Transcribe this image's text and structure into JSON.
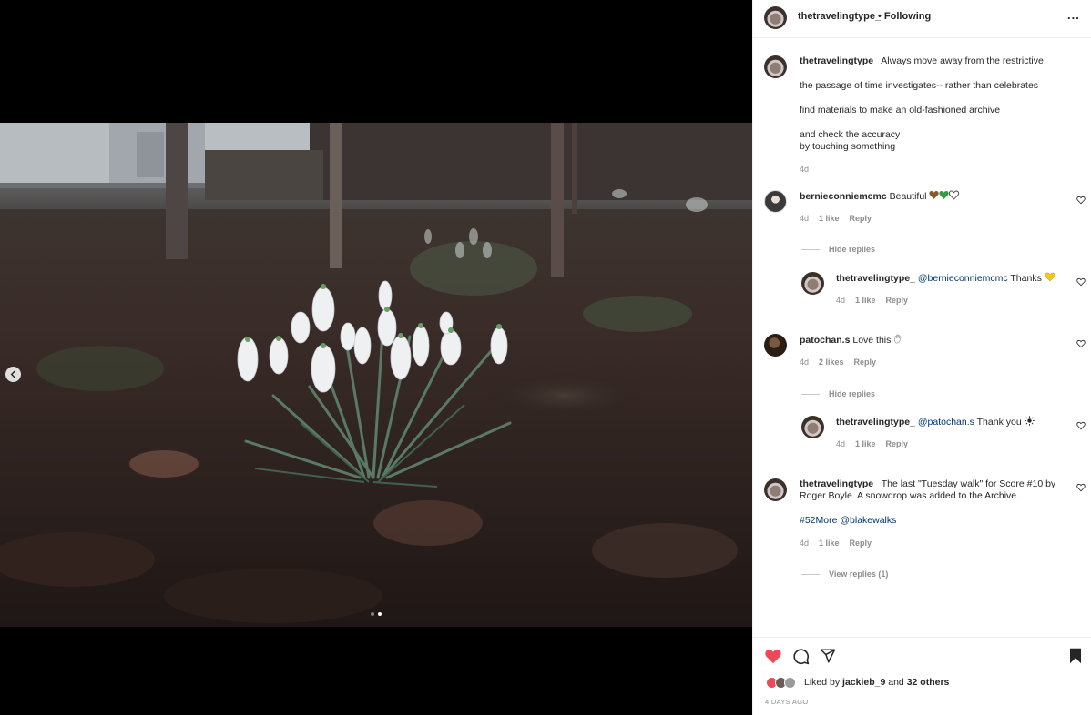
{
  "post": {
    "author": "thetravelingtype_",
    "separator": "•",
    "follow_status": "Following",
    "more_label": "...",
    "carousel": {
      "slide_count": 2,
      "active_slide": 2
    }
  },
  "caption": {
    "username": "thetravelingtype_",
    "line1": "Always move away from the restrictive",
    "line2": "the passage of time investigates-- rather than celebrates",
    "line3": "find materials to make an old-fashioned archive",
    "line4": "and check the accuracy",
    "line5": "by touching something",
    "time": "4d"
  },
  "comments": [
    {
      "username": "bernieconniemcmc",
      "text": "Beautiful",
      "emoji": [
        "brown-heart",
        "green-heart",
        "white-heart"
      ],
      "time": "4d",
      "likes": "1 like",
      "reply_label": "Reply",
      "toggle_label": "Hide replies",
      "reply": {
        "username": "thetravelingtype_",
        "mention": "@bernieconniemcmc",
        "text": "Thanks",
        "emoji": "yellow-heart",
        "time": "4d",
        "likes": "1 like",
        "reply_label": "Reply"
      }
    },
    {
      "username": "patochan.s",
      "text": "Love this",
      "emoji": "hand-icon",
      "time": "4d",
      "likes": "2 likes",
      "reply_label": "Reply",
      "toggle_label": "Hide replies",
      "reply": {
        "username": "thetravelingtype_",
        "mention": "@patochan.s",
        "text": "Thank you",
        "emoji": "sun-icon",
        "time": "4d",
        "likes": "1 like",
        "reply_label": "Reply"
      }
    },
    {
      "username": "thetravelingtype_",
      "text_line1": "The last \"Tuesday walk\" for Score #10 by",
      "text_line2": "Roger Boyle. A snowdrop was added to the Archive.",
      "hashtag": "#52More",
      "mention": "@blakewalks",
      "time": "4d",
      "likes": "1 like",
      "reply_label": "Reply",
      "toggle_label": "View replies (1)"
    }
  ],
  "footer": {
    "liked_prefix": "Liked by",
    "liked_user": "jackieb_9",
    "liked_and": "and",
    "liked_others": "32 others",
    "timestamp": "4 DAYS AGO",
    "like_color": "#ed4956",
    "icons": [
      "heart-icon",
      "comment-icon",
      "share-icon",
      "bookmark-icon"
    ]
  }
}
